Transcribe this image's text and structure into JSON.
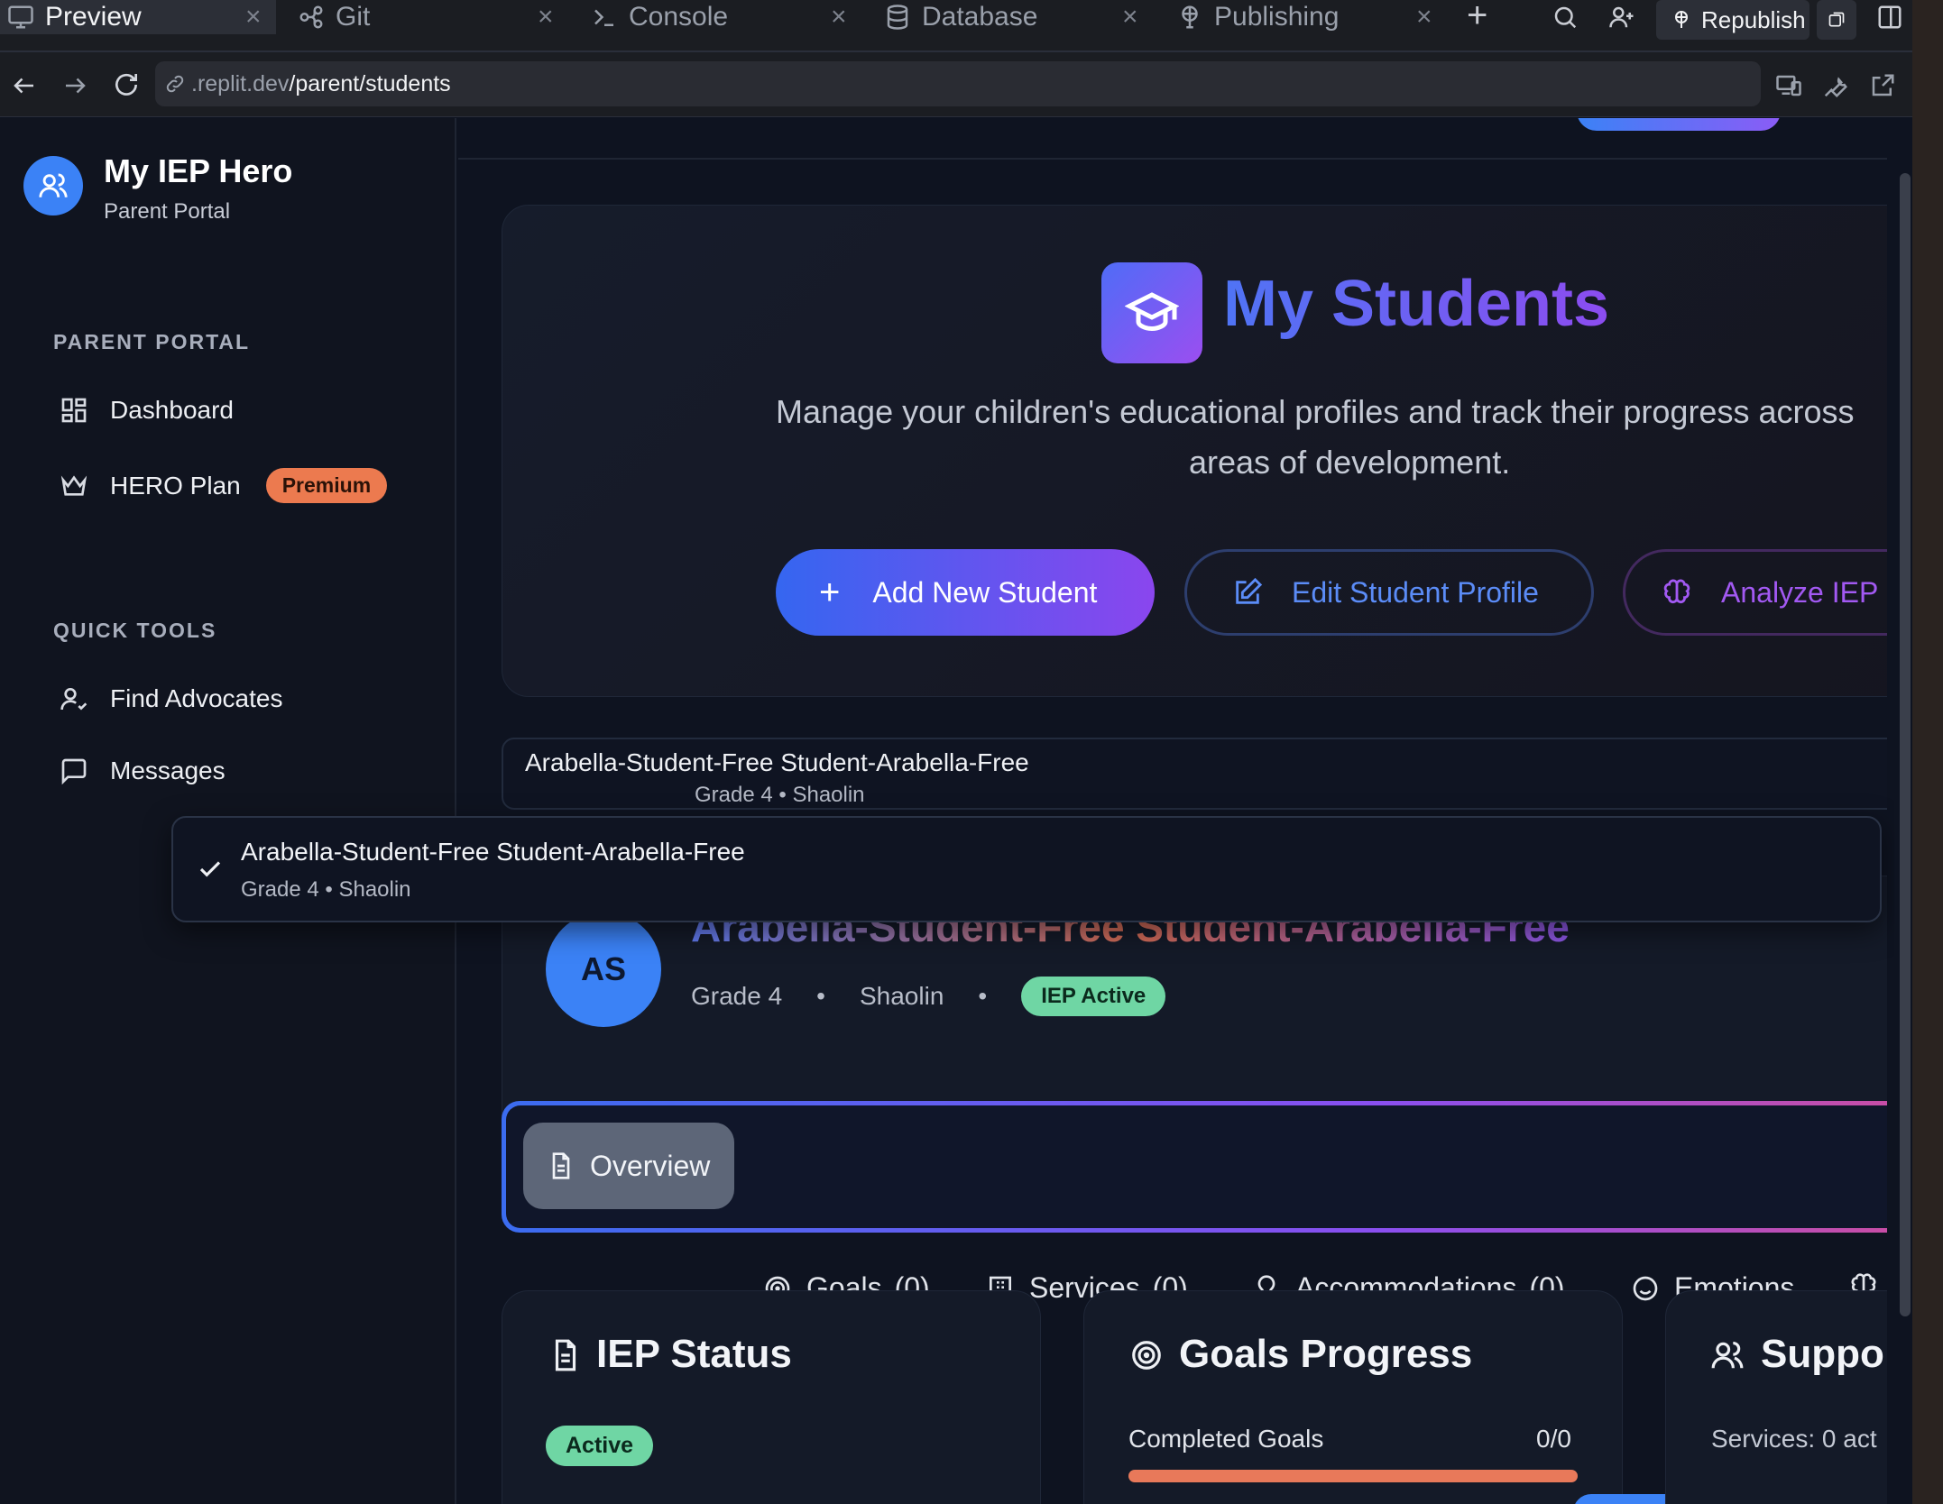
{
  "ide": {
    "tabs": [
      {
        "label": "Preview",
        "icon": "monitor-icon",
        "active": true
      },
      {
        "label": "Git",
        "icon": "git-branch-icon"
      },
      {
        "label": "Console",
        "icon": "terminal-icon"
      },
      {
        "label": "Database",
        "icon": "database-icon"
      },
      {
        "label": "Publishing",
        "icon": "publishing-icon"
      }
    ],
    "republish_label": "Republish",
    "url_prefix": ".replit.dev",
    "url_path": "/parent/students"
  },
  "sidebar": {
    "app_name": "My IEP Hero",
    "app_subtitle": "Parent Portal",
    "section_portal": "PARENT PORTAL",
    "section_tools": "QUICK TOOLS",
    "items": [
      {
        "label": "Dashboard",
        "icon": "dashboard-grid-icon"
      },
      {
        "label": "HERO Plan",
        "icon": "crown-icon",
        "badge": "Premium"
      },
      {
        "label": "Find Advocates",
        "icon": "user-check-icon"
      },
      {
        "label": "Messages",
        "icon": "message-square-icon"
      }
    ]
  },
  "hero": {
    "title": "My Students",
    "description_line1": "Manage your children's educational profiles and track their progress across",
    "description_line2": "areas of development.",
    "add_button": "Add New Student",
    "edit_button": "Edit Student Profile",
    "analyze_button": "Analyze IEP"
  },
  "student_select": {
    "name": "Arabella-Student-Free Student-Arabella-Free",
    "meta": "Grade 4 • Shaolin"
  },
  "dropdown": {
    "option_name": "Arabella-Student-Free Student-Arabella-Free",
    "option_meta": "Grade 4 • Shaolin"
  },
  "student": {
    "initials": "AS",
    "name": "Arabella-Student-Free Student-Arabella-Free",
    "grade": "Grade 4",
    "school": "Shaolin",
    "bullet": "•",
    "iep_badge": "IEP Active"
  },
  "tabs": [
    {
      "label": "Overview",
      "count": "",
      "icon": "document-icon",
      "active": true
    },
    {
      "label": "Goals",
      "count": "(0)",
      "icon": "target-icon"
    },
    {
      "label": "Services",
      "count": "(0)",
      "icon": "building-icon"
    },
    {
      "label": "Accommodations",
      "count": "(0)",
      "icon": "lightbulb-icon"
    },
    {
      "label": "Emotions",
      "count": "",
      "icon": "smile-icon"
    }
  ],
  "cards": {
    "iep_status": {
      "title": "IEP Status",
      "badge": "Active"
    },
    "goals_progress": {
      "title": "Goals Progress",
      "label": "Completed Goals",
      "value": "0/0",
      "progress": 0
    },
    "support": {
      "title": "Suppo",
      "line": "Services: 0 act"
    }
  },
  "colors": {
    "accent_blue": "#3b82f6",
    "accent_purple": "#8b5cf6",
    "premium_orange": "#ec7a4f",
    "active_green": "#6fd6a4",
    "progress_orange": "#e8795a"
  }
}
